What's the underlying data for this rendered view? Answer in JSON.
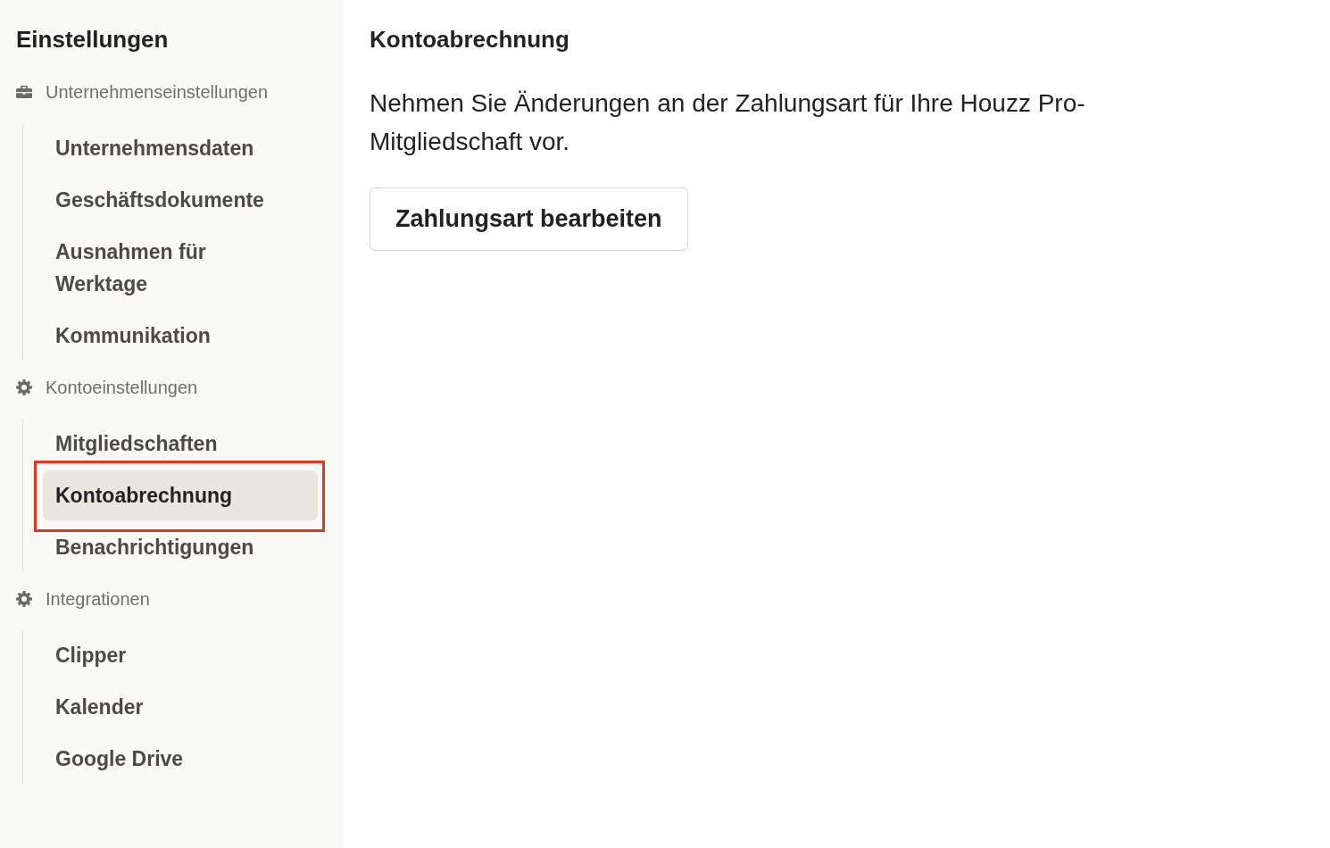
{
  "sidebar": {
    "title": "Einstellungen",
    "sections": [
      {
        "label": "Unternehmenseinstellungen",
        "kind": "company",
        "items": [
          {
            "label": "Unternehmensdaten",
            "selected": false,
            "highlighted": false
          },
          {
            "label": "Geschäftsdokumente",
            "selected": false,
            "highlighted": false
          },
          {
            "label": "Ausnahmen für Werktage",
            "selected": false,
            "highlighted": false
          },
          {
            "label": "Kommunikation",
            "selected": false,
            "highlighted": false
          }
        ]
      },
      {
        "label": "Kontoeinstellungen",
        "kind": "account",
        "items": [
          {
            "label": "Mitgliedschaften",
            "selected": false,
            "highlighted": false
          },
          {
            "label": "Kontoabrechnung",
            "selected": true,
            "highlighted": true
          },
          {
            "label": "Benachrichtigungen",
            "selected": false,
            "highlighted": false
          }
        ]
      },
      {
        "label": "Integrationen",
        "kind": "integration",
        "items": [
          {
            "label": "Clipper",
            "selected": false,
            "highlighted": false
          },
          {
            "label": "Kalender",
            "selected": false,
            "highlighted": false
          },
          {
            "label": "Google Drive",
            "selected": false,
            "highlighted": false
          }
        ]
      }
    ]
  },
  "content": {
    "title": "Kontoabrechnung",
    "description": "Nehmen Sie Änderungen an der Zahlungsart für Ihre Houzz Pro-Mitgliedschaft vor.",
    "button": "Zahlungsart bearbeiten"
  }
}
